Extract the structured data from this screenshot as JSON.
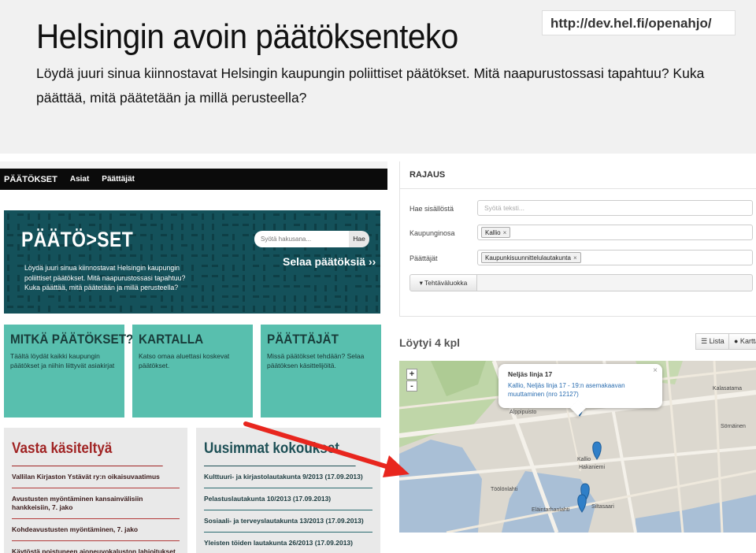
{
  "slide": {
    "title": "Helsingin avoin päätöksenteko",
    "subtitle": "Löydä juuri sinua kiinnostavat Helsingin kaupungin poliittiset päätökset. Mitä naapurustossasi tapahtuu? Kuka päättää, mitä päätetään ja millä perusteella?",
    "url": "http://dev.hel.fi/openahjo/"
  },
  "nav": {
    "brand": "PÄÄTÖKSET",
    "items": [
      "Asiat",
      "Päättäjät"
    ]
  },
  "hero": {
    "logo": "PÄÄTÖ>SET",
    "text": "Löydä juuri sinua kiinnostavat Helsingin kaupungin poliittiset päätökset. Mitä naapurustossasi tapahtuu? Kuka päättää, mitä päätetään ja millä perusteella?",
    "search_placeholder": "Syötä hakusana...",
    "search_button": "Hae",
    "browse": "Selaa päätöksiä ››"
  },
  "tiles": [
    {
      "heading": "MITKÄ PÄÄTÖKSET?",
      "text": "Täältä löydät kaikki kaupungin päätökset ja niihin liittyvät asiakirjat"
    },
    {
      "heading": "KARTALLA",
      "text": "Katso omaa aluettasi koskevat päätökset."
    },
    {
      "heading": "PÄÄTTÄJÄT",
      "text": "Missä päätökset tehdään? Selaa päätöksen käsittelijöitä."
    }
  ],
  "recent": {
    "heading": "Vasta käsiteltyä",
    "items": [
      "Vallilan Kirjaston Ystävät ry:n oikaisuvaatimus",
      "Avustusten myöntäminen kansainvälisiin hankkeisiin, 7. jako",
      "Kohdeavustusten myöntäminen, 7. jako",
      "Käytöstä poistuneen ajoneuvokaluston lahjoitukset sopimuspalokunnille"
    ]
  },
  "meetings": {
    "heading": "Uusimmat kokoukset",
    "items": [
      "Kulttuuri- ja kirjastolautakunta 9/2013 (17.09.2013)",
      "Pelastuslautakunta 10/2013 (17.09.2013)",
      "Sosiaali- ja terveyslautakunta 13/2013 (17.09.2013)",
      "Yleisten töiden lautakunta 26/2013 (17.09.2013)"
    ]
  },
  "filter": {
    "heading": "RAJAUS",
    "search_label": "Hae sisällöstä",
    "search_placeholder": "Syötä teksti...",
    "district_label": "Kaupunginosa",
    "district_chip": "Kallio",
    "decider_label": "Päättäjät",
    "decider_chip": "Kaupunkisuunnittelulautakunta",
    "class_button": "▾ Tehtäväluokka",
    "chip_remove": "×"
  },
  "results": {
    "found": "Löytyi 4 kpl",
    "list_button": "☰ Lista",
    "map_button": "● Kartta"
  },
  "map": {
    "zoom_in": "+",
    "zoom_out": "-",
    "popup_title": "Neljäs linja 17",
    "popup_link": "Kallio, Neljäs linja 17 - 19:n asemakaavan muuttaminen (nro 12127)",
    "popup_close": "×",
    "labels": [
      "Alppipuisto",
      "Kallio",
      "Hakaniemi",
      "Töölönlahti",
      "Eläintarhanlahti",
      "Kalasatama",
      "Sörnäinen",
      "Siltasaari"
    ],
    "pin_color": "#2f7fc8"
  },
  "colors": {
    "hero": "#14515a",
    "tile": "#58bfae",
    "red_heading": "#a02323",
    "teal_heading": "#1d4f55",
    "arrow": "#e8261e"
  }
}
